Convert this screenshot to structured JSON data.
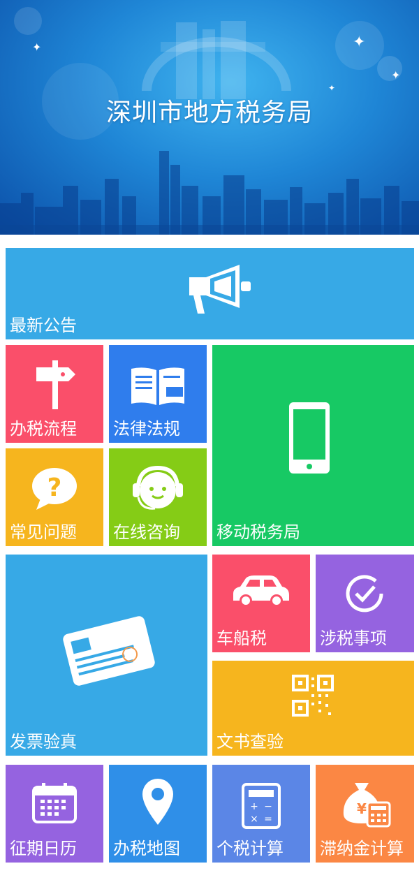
{
  "header": {
    "title": "深圳市地方税务局"
  },
  "tiles": {
    "announcements": {
      "label": "最新公告",
      "color": "#37a9e6",
      "icon": "megaphone-icon"
    },
    "tax_process": {
      "label": "办税流程",
      "color": "#fa4f6a",
      "icon": "signpost-icon"
    },
    "laws": {
      "label": "法律法规",
      "color": "#2f7ded",
      "icon": "book-icon"
    },
    "mobile_bureau": {
      "label": "移动税务局",
      "color": "#17c964",
      "icon": "phone-icon"
    },
    "faq": {
      "label": "常见问题",
      "color": "#f6b51e",
      "icon": "question-bubble-icon"
    },
    "online_consult": {
      "label": "在线咨询",
      "color": "#85cc16",
      "icon": "headset-agent-icon"
    },
    "invoice_verify": {
      "label": "发票验真",
      "color": "#37a9e6",
      "icon": "invoice-card-icon"
    },
    "vehicle_tax": {
      "label": "车船税",
      "color": "#fa4f6a",
      "icon": "car-icon"
    },
    "tax_matters": {
      "label": "涉税事项",
      "color": "#9563e0",
      "icon": "check-circle-icon"
    },
    "document_check": {
      "label": "文书查验",
      "color": "#f6b51e",
      "icon": "qr-code-icon"
    },
    "calendar": {
      "label": "征期日历",
      "color": "#9563e0",
      "icon": "calendar-icon"
    },
    "tax_map": {
      "label": "办税地图",
      "color": "#2f8fe8",
      "icon": "map-pin-icon"
    },
    "income_tax_calc": {
      "label": "个税计算",
      "color": "#5b86e6",
      "icon": "calculator-icon"
    },
    "late_fee_calc": {
      "label": "滞纳金计算",
      "color": "#fb8744",
      "icon": "money-bag-calculator-icon"
    }
  }
}
